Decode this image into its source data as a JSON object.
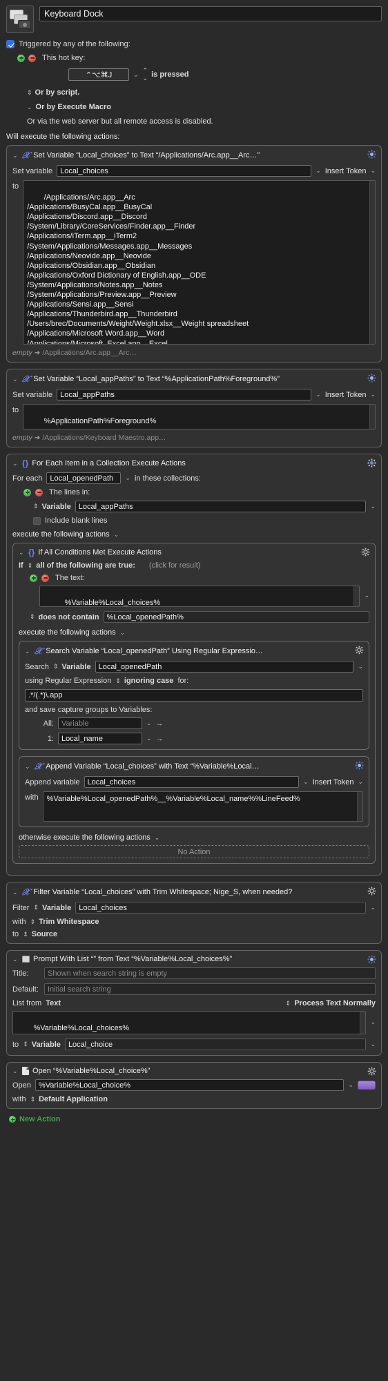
{
  "header": {
    "macro_title": "Keyboard Dock",
    "icon": "keyboard-dock-icon"
  },
  "trigger": {
    "checkbox_label": "Triggered by any of the following:",
    "hotkey_label": "This hot key:",
    "hotkey_value": "⌃⌥⌘J",
    "hotkey_condition": "is pressed",
    "or_by_script": "Or by script.",
    "or_by_execute_macro": "Or by Execute Macro",
    "web_server_note": "Or via the web server but all remote access is disabled.",
    "will_execute": "Will execute the following actions:"
  },
  "actions": {
    "set_choices": {
      "title": "Set Variable “Local_choices” to Text “/Applications/Arc.app__Arc…”",
      "set_variable_label": "Set variable",
      "variable_name": "Local_choices",
      "insert_token": "Insert Token",
      "to_label": "to",
      "text_value": "/Applications/Arc.app__Arc\n/Applications/BusyCal.app__BusyCal\n/Applications/Discord.app__Discord\n/System/Library/CoreServices/Finder.app__Finder\n/Applications/iTerm.app__iTerm2\n/System/Applications/Messages.app__Messages\n/Applications/Neovide.app__Neovide\n/Applications/Obsidian.app__Obsidian\n/Applications/Oxford Dictionary of English.app__ODE\n/System/Applications/Notes.app__Notes\n/System/Applications/Preview.app__Preview\n/Applications/Sensi.app__Sensi\n/Applications/Thunderbird.app__Thunderbird\n/Users/brec/Documents/Weight/Weight.xlsx__Weight spreadsheet\n/Applications/Microsoft Word.app__Word\n/Applications/Microsoft  Excel.app__Excel",
      "footnote_from": "empty",
      "footnote_arrow": "➜",
      "footnote_to": "/Applications/Arc.app__Arc…"
    },
    "set_app_paths": {
      "title": "Set Variable “Local_appPaths” to Text “%ApplicationPath%Foreground%”",
      "set_variable_label": "Set variable",
      "variable_name": "Local_appPaths",
      "insert_token": "Insert Token",
      "to_label": "to",
      "text_value": "%ApplicationPath%Foreground%",
      "footnote_from": "empty",
      "footnote_arrow": "➜",
      "footnote_to": "/Applications/Keyboard Maestro.app…"
    },
    "for_each": {
      "title": "For Each Item in a Collection Execute Actions",
      "for_each_label": "For each",
      "loop_variable": "Local_openedPath",
      "in_collections_label": "in these collections:",
      "lines_in_label": "The lines in:",
      "source_kind": "Variable",
      "source_variable": "Local_appPaths",
      "include_blank_lines": "Include blank lines",
      "execute_label": "execute the following actions"
    },
    "if_block": {
      "title": "If All Conditions Met Execute Actions",
      "if_label": "If",
      "all_true_label": "all of the following are true:",
      "click_for_result": "(click for result)",
      "the_text_label": "The text:",
      "text_value": "%Variable%Local_choices%",
      "operator": "does not contain",
      "operand": "%Local_openedPath%",
      "execute_label": "execute the following actions",
      "otherwise_label": "otherwise execute the following actions",
      "no_action": "No Action"
    },
    "search_regex": {
      "title": "Search Variable “Local_openedPath” Using Regular Expressio…",
      "search_label": "Search",
      "source_kind": "Variable",
      "source_variable": "Local_openedPath",
      "using_regex_label": "using Regular Expression",
      "ignoring_case_label": "ignoring case",
      "for_label": "for:",
      "regex_value": ".*/(.*)\\.app",
      "save_groups_label": "and save capture groups to Variables:",
      "all_label": "All:",
      "all_value": "Variable",
      "group1_label": "1:",
      "group1_value": "Local_name"
    },
    "append": {
      "title": "Append Variable “Local_choices” with Text “%Variable%Local…",
      "append_label": "Append variable",
      "variable_name": "Local_choices",
      "insert_token": "Insert Token",
      "with_label": "with",
      "text_value": "%Variable%Local_openedPath%__%Variable%Local_name%%LineFeed%"
    },
    "filter": {
      "title": "Filter Variable “Local_choices” with Trim Whitespace; Nige_S, when needed?",
      "filter_label": "Filter",
      "source_kind": "Variable",
      "source_variable": "Local_choices",
      "with_label": "with",
      "filter_type": "Trim Whitespace",
      "to_label": "to",
      "destination": "Source"
    },
    "prompt_list": {
      "title": "Prompt With List “” from Text “%Variable%Local_choices%”",
      "title_label": "Title:",
      "title_placeholder": "Shown when search string is empty",
      "default_label": "Default:",
      "default_placeholder": "Initial search string",
      "list_from_label": "List from",
      "list_from_value": "Text",
      "process_label": "Process Text Normally",
      "list_text": "%Variable%Local_choices%",
      "to_label": "to",
      "to_kind": "Variable",
      "to_variable": "Local_choice"
    },
    "open": {
      "title": "Open “%Variable%Local_choice%”",
      "open_label": "Open",
      "open_value": "%Variable%Local_choice%",
      "with_label": "with",
      "application": "Default Application"
    }
  },
  "footer": {
    "new_action": "New Action"
  }
}
